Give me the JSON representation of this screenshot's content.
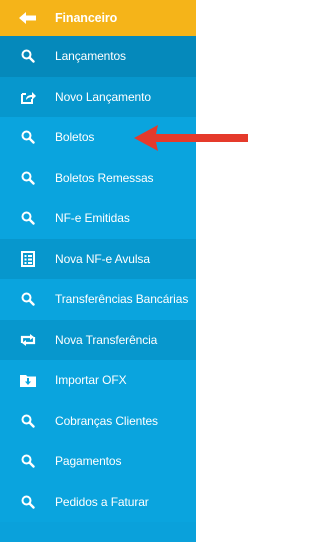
{
  "menu": {
    "header": {
      "label": "Financeiro",
      "icon": "back-arrow-icon"
    },
    "items": [
      {
        "label": "Lançamentos",
        "icon": "search-icon",
        "shade": "dark"
      },
      {
        "label": "Novo Lançamento",
        "icon": "external-link-icon",
        "shade": "mid"
      },
      {
        "label": "Boletos",
        "icon": "search-icon",
        "shade": "light"
      },
      {
        "label": "Boletos Remessas",
        "icon": "search-icon",
        "shade": "light"
      },
      {
        "label": "NF-e Emitidas",
        "icon": "search-icon",
        "shade": "light"
      },
      {
        "label": "Nova NF-e Avulsa",
        "icon": "document-list-icon",
        "shade": "mid"
      },
      {
        "label": "Transferências Bancárias",
        "icon": "search-icon",
        "shade": "light"
      },
      {
        "label": "Nova Transferência",
        "icon": "transfer-icon",
        "shade": "mid"
      },
      {
        "label": "Importar OFX",
        "icon": "import-folder-icon",
        "shade": "light"
      },
      {
        "label": "Cobranças Clientes",
        "icon": "search-icon",
        "shade": "light"
      },
      {
        "label": "Pagamentos",
        "icon": "search-icon",
        "shade": "light"
      },
      {
        "label": "Pedidos a Faturar",
        "icon": "search-icon",
        "shade": "light"
      }
    ]
  },
  "annotation": {
    "icon": "red-arrow-pointer-icon",
    "color": "#e53a2b"
  },
  "colors": {
    "header_bg": "#f5b419",
    "sidebar_bg": "#0aa1db",
    "text": "#ffffff"
  }
}
